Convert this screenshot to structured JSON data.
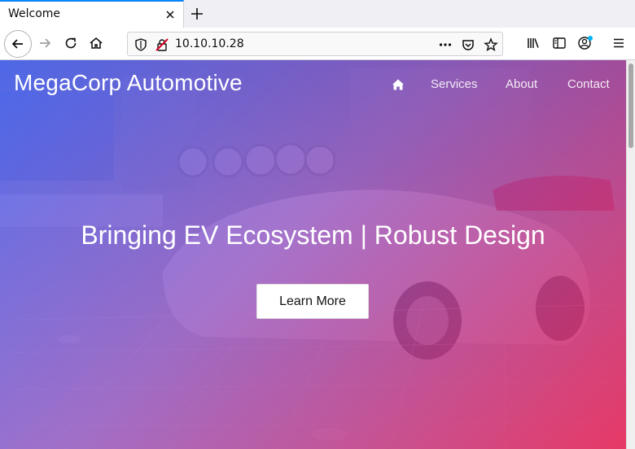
{
  "browser": {
    "tab_title": "Welcome",
    "url": "10.10.10.28"
  },
  "page": {
    "brand": "MegaCorp Automotive",
    "nav": [
      "Services",
      "About",
      "Contact"
    ],
    "headline": "Bringing EV Ecosystem | Robust Design",
    "cta_label": "Learn More"
  },
  "icons": {
    "tab_close": "close-icon",
    "new_tab": "plus-icon",
    "back": "arrow-left-icon",
    "forward": "arrow-right-icon",
    "reload": "reload-icon",
    "home": "home-icon",
    "shield": "shield-icon",
    "insecure": "crossed-lock-icon",
    "page_actions": "ellipsis-icon",
    "pocket": "pocket-icon",
    "bookmark": "star-icon",
    "library": "library-icon",
    "sidebar": "sidebar-icon",
    "account": "account-icon",
    "menu": "hamburger-icon",
    "site_home": "home-icon"
  },
  "colors": {
    "accent": "#0a84ff",
    "gradient_start": "#3f5efb",
    "gradient_end": "#e82355",
    "cta_background": "#ffffff"
  }
}
